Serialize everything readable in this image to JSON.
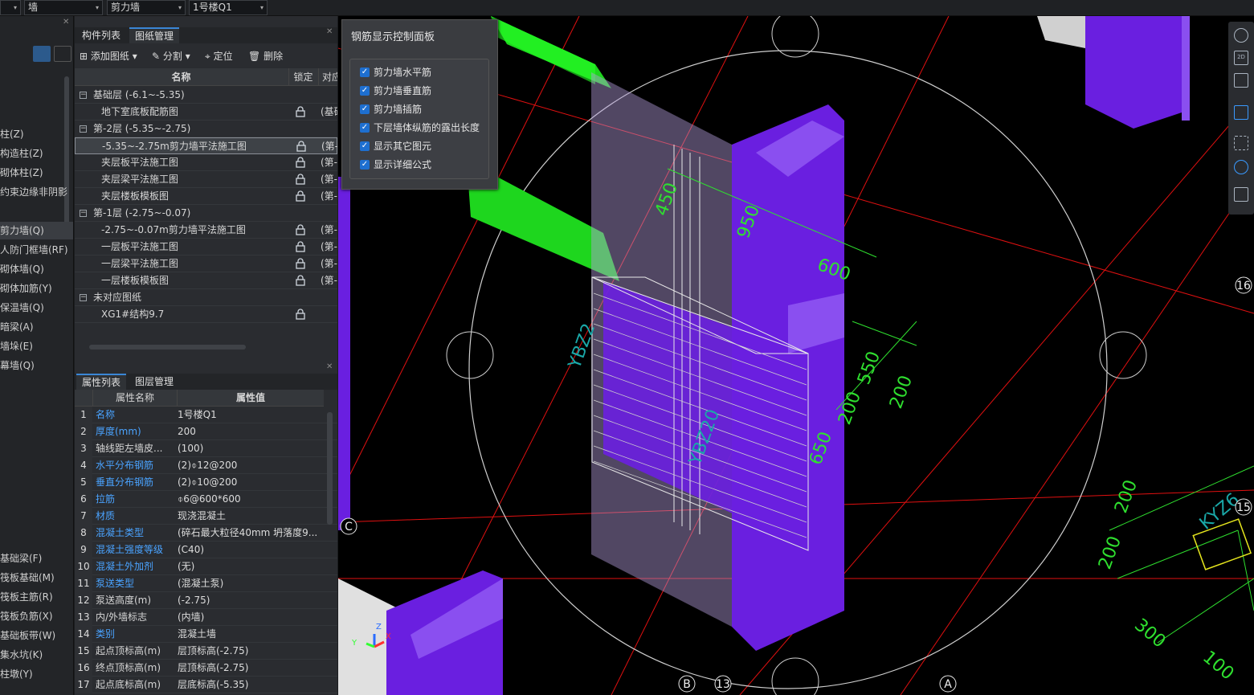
{
  "topbar": {
    "dropdowns": [
      "墙",
      "剪力墙",
      "1号楼Q1"
    ]
  },
  "left_panel": {
    "items": [
      "柱(Z)",
      "构造柱(Z)",
      "砌体柱(Z)",
      "约束边缘非阴影",
      "剪力墙(Q)",
      "人防门框墙(RF)",
      "砌体墙(Q)",
      "砌体加筋(Y)",
      "保温墙(Q)",
      "暗梁(A)",
      "墙垛(E)",
      "幕墙(Q)",
      "基础梁(F)",
      "筏板基础(M)",
      "筏板主筋(R)",
      "筏板负筋(X)",
      "基础板带(W)",
      "集水坑(K)",
      "柱墩(Y)"
    ]
  },
  "drawing_panel": {
    "tabs": [
      "构件列表",
      "图纸管理"
    ],
    "toolbar": [
      "添加图纸",
      "分割",
      "定位",
      "删除"
    ],
    "headers": [
      "名称",
      "锁定",
      "对应"
    ],
    "rows": [
      {
        "name": "基础层 (-6.1~-5.35)",
        "group": true,
        "lock": "",
        "ref": ""
      },
      {
        "name": "地下室底板配筋图",
        "group": false,
        "lock": "lock",
        "ref": "(基础"
      },
      {
        "name": "第-2层 (-5.35~-2.75)",
        "group": true,
        "lock": "",
        "ref": ""
      },
      {
        "name": "-5.35~-2.75m剪力墙平法施工图",
        "group": false,
        "lock": "lock",
        "ref": "(第-",
        "selected": true
      },
      {
        "name": "夹层板平法施工图",
        "group": false,
        "lock": "lock",
        "ref": "(第-"
      },
      {
        "name": "夹层梁平法施工图",
        "group": false,
        "lock": "lock",
        "ref": "(第-"
      },
      {
        "name": "夹层楼板模板图",
        "group": false,
        "lock": "lock",
        "ref": "(第-"
      },
      {
        "name": "第-1层 (-2.75~-0.07)",
        "group": true,
        "lock": "",
        "ref": ""
      },
      {
        "name": "-2.75~-0.07m剪力墙平法施工图",
        "group": false,
        "lock": "lock",
        "ref": "(第-"
      },
      {
        "name": "一层板平法施工图",
        "group": false,
        "lock": "lock",
        "ref": "(第-"
      },
      {
        "name": "一层梁平法施工图",
        "group": false,
        "lock": "lock",
        "ref": "(第-"
      },
      {
        "name": "一层楼板模板图",
        "group": false,
        "lock": "lock",
        "ref": "(第-"
      },
      {
        "name": "未对应图纸",
        "group": true,
        "lock": "",
        "ref": ""
      },
      {
        "name": "XG1#结构9.7",
        "group": false,
        "lock": "lock",
        "ref": ""
      }
    ]
  },
  "property_panel": {
    "tabs": [
      "属性列表",
      "图层管理"
    ],
    "headers": [
      "属性名称",
      "属性值"
    ],
    "rows": [
      {
        "n": "1",
        "key": "名称",
        "val": "1号楼Q1",
        "blue": true
      },
      {
        "n": "2",
        "key": "厚度(mm)",
        "val": "200",
        "blue": true
      },
      {
        "n": "3",
        "key": "轴线距左墙皮...",
        "val": "(100)",
        "blue": false
      },
      {
        "n": "4",
        "key": "水平分布钢筋",
        "val": "(2)⌽12@200",
        "blue": true
      },
      {
        "n": "5",
        "key": "垂直分布钢筋",
        "val": "(2)⌽10@200",
        "blue": true
      },
      {
        "n": "6",
        "key": "拉筋",
        "val": "⌽6@600*600",
        "blue": true
      },
      {
        "n": "7",
        "key": "材质",
        "val": "现浇混凝土",
        "blue": true
      },
      {
        "n": "8",
        "key": "混凝土类型",
        "val": "(碎石最大粒径40mm 坍落度9...",
        "blue": true
      },
      {
        "n": "9",
        "key": "混凝土强度等级",
        "val": "(C40)",
        "blue": true
      },
      {
        "n": "10",
        "key": "混凝土外加剂",
        "val": "(无)",
        "blue": true
      },
      {
        "n": "11",
        "key": "泵送类型",
        "val": "(混凝土泵)",
        "blue": true
      },
      {
        "n": "12",
        "key": "泵送高度(m)",
        "val": "(-2.75)",
        "blue": false
      },
      {
        "n": "13",
        "key": "内/外墙标志",
        "val": "(内墙)",
        "blue": false
      },
      {
        "n": "14",
        "key": "类别",
        "val": "混凝土墙",
        "blue": true
      },
      {
        "n": "15",
        "key": "起点顶标高(m)",
        "val": "层顶标高(-2.75)",
        "blue": false
      },
      {
        "n": "16",
        "key": "终点顶标高(m)",
        "val": "层顶标高(-2.75)",
        "blue": false
      },
      {
        "n": "17",
        "key": "起点底标高(m)",
        "val": "层底标高(-5.35)",
        "blue": false
      }
    ]
  },
  "rebar_panel": {
    "title": "钢筋显示控制面板",
    "options": [
      {
        "label": "剪力墙水平筋",
        "checked": true
      },
      {
        "label": "剪力墙垂直筋",
        "checked": true
      },
      {
        "label": "剪力墙插筋",
        "checked": true
      },
      {
        "label": "下层墙体纵筋的露出长度",
        "checked": true
      },
      {
        "label": "显示其它图元",
        "checked": true
      },
      {
        "label": "显示详细公式",
        "checked": true
      }
    ]
  },
  "viewport": {
    "axis_labels": [
      "16",
      "15",
      "C",
      "B",
      "13",
      "A"
    ],
    "dim_labels": [
      "450",
      "950",
      "600",
      "550",
      "200",
      "200",
      "650",
      "200",
      "200",
      "300",
      "100"
    ],
    "wall_labels": [
      "YBZ2",
      "YBZ20",
      "KYZ6"
    ],
    "colors": {
      "wall": "#6a1fe0",
      "beam": "#1ed61e",
      "grid": "#e01010",
      "dim": "#2fe02f",
      "label": "#1aa8a8"
    }
  },
  "right_toolbar": {
    "icons": [
      "orbit-icon",
      "2d-view-icon",
      "3d-box-icon",
      "3d-box-filled-icon",
      "fullscreen-icon",
      "component-icon",
      "report-icon"
    ]
  }
}
